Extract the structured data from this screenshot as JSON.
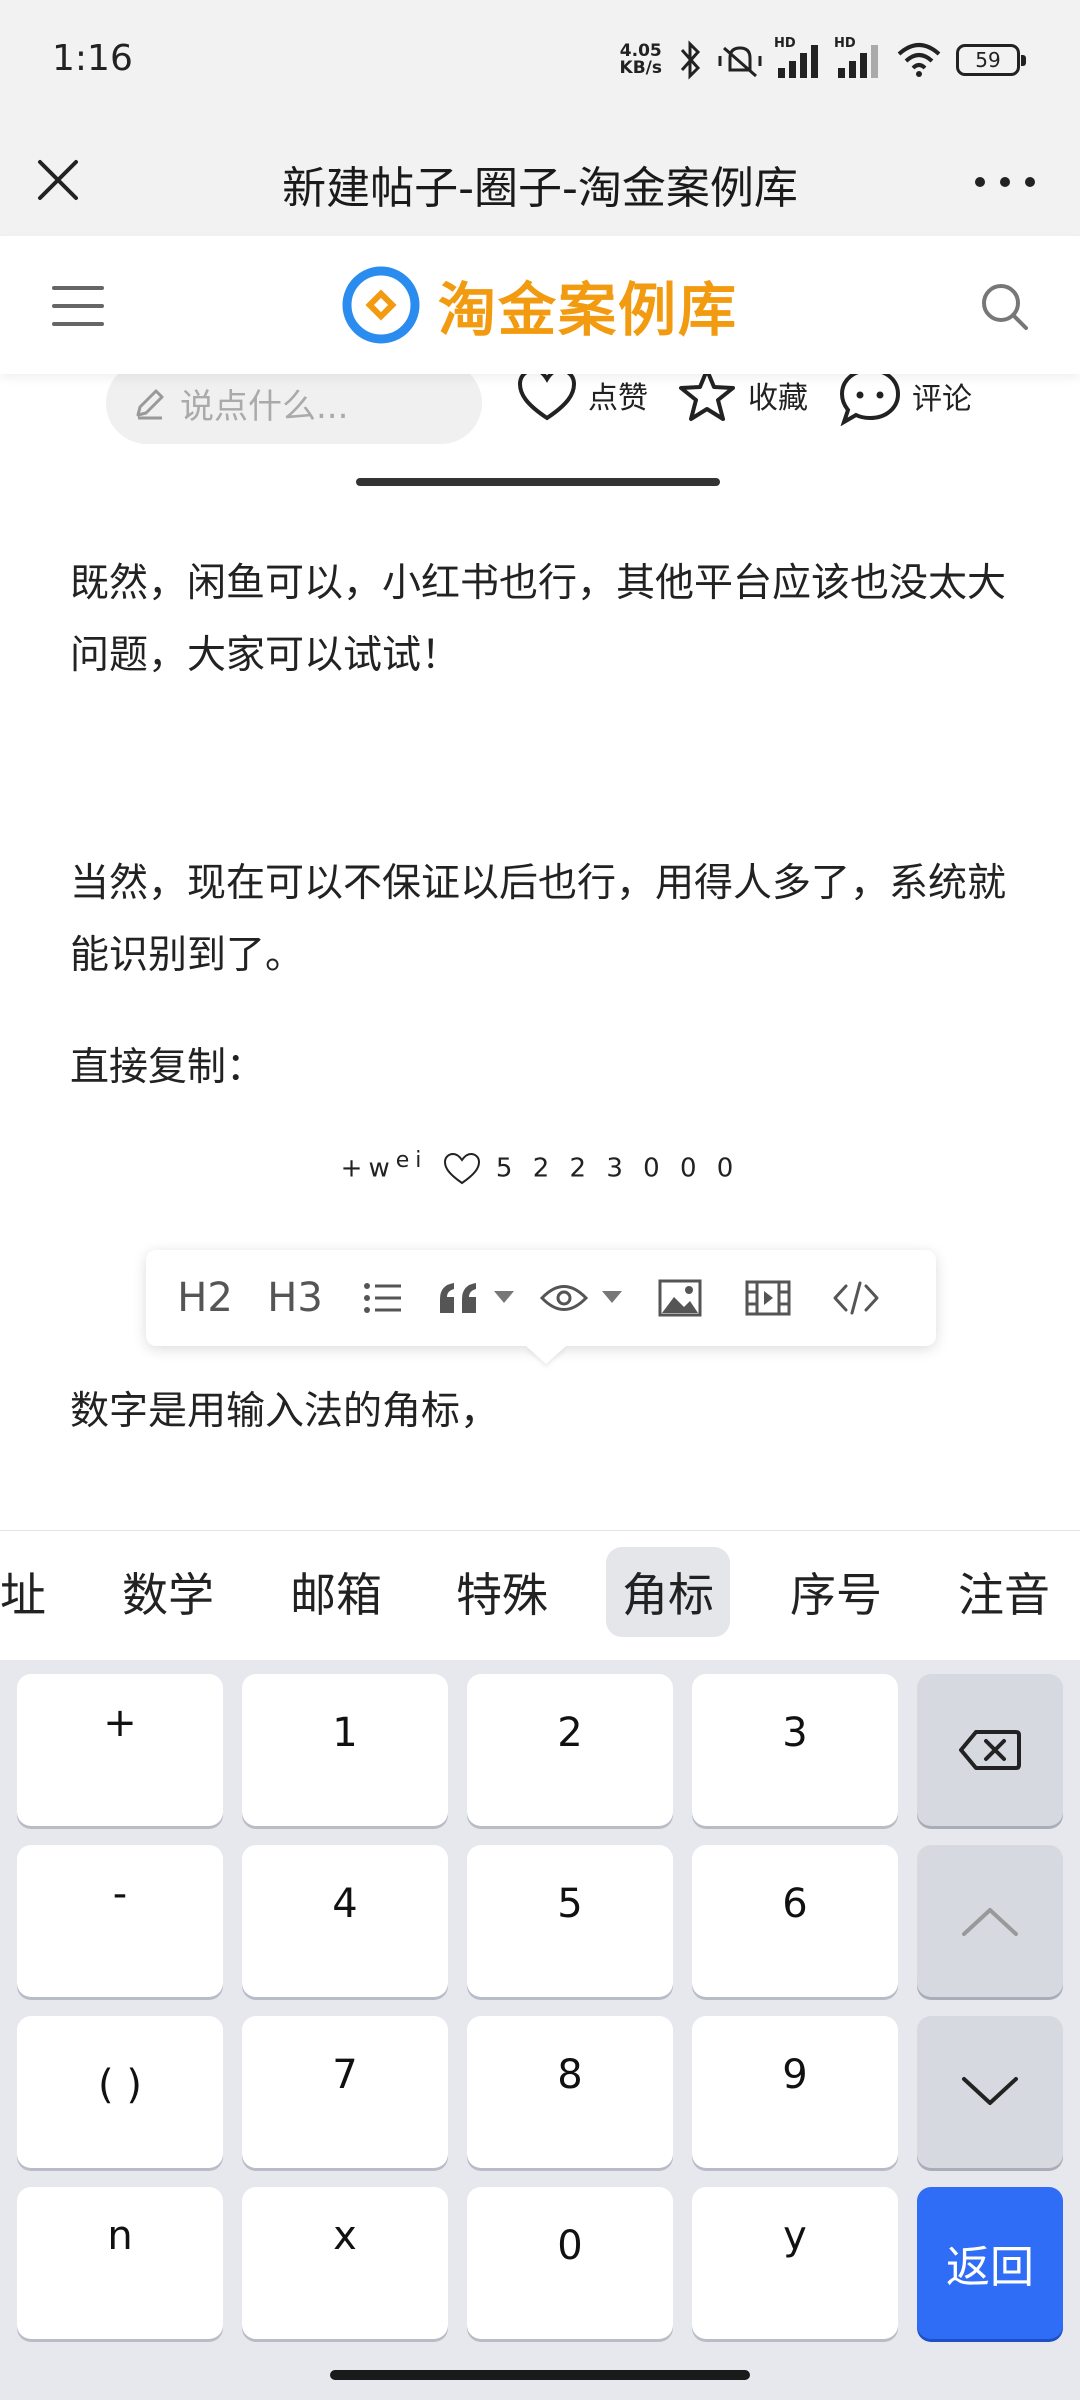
{
  "status_bar": {
    "time": "1:16",
    "net_speed_value": "4.05",
    "net_speed_unit": "KB/s",
    "signal_1_label": "HD",
    "signal_2_label": "HD",
    "battery": "59"
  },
  "title_bar": {
    "title": "新建帖子-圈子-淘金案例库"
  },
  "site_header": {
    "logo_text": "淘金案例库",
    "brand_color": "#f29a10",
    "logo_ring_color": "#2b8cf0"
  },
  "action_row": {
    "comment_placeholder": "说点什么...",
    "like_label": "点赞",
    "favorite_label": "收藏",
    "comment_label": "评论"
  },
  "content": {
    "paragraph_1": "既然，闲鱼可以，小红书也行，其他平台应该也没太大问题，大家可以试试！",
    "paragraph_2": "当然，现在可以不保证以后也行，用得人多了，系统就能识别到了。",
    "paragraph_3": "直接复制：",
    "emoji_prefix": "+w",
    "emoji_sup": "ei",
    "emoji_number": "5 2 2 3 0 0 0",
    "paragraph_4": "数字是用输入法的角标，"
  },
  "toolbar": {
    "h2": "H2",
    "h3": "H3"
  },
  "candidates": {
    "items": [
      "址",
      "数学",
      "邮箱",
      "特殊",
      "角标",
      "序号",
      "注音"
    ],
    "selected": "角标"
  },
  "keyboard": {
    "rows": [
      [
        "+",
        "1",
        "2",
        "3"
      ],
      [
        "-",
        "4",
        "5",
        "6"
      ],
      [
        "( )",
        "7",
        "8",
        "9"
      ],
      [
        "n",
        "x",
        "0",
        "y"
      ]
    ],
    "return_label": "返回",
    "return_color": "#2f6df6"
  }
}
